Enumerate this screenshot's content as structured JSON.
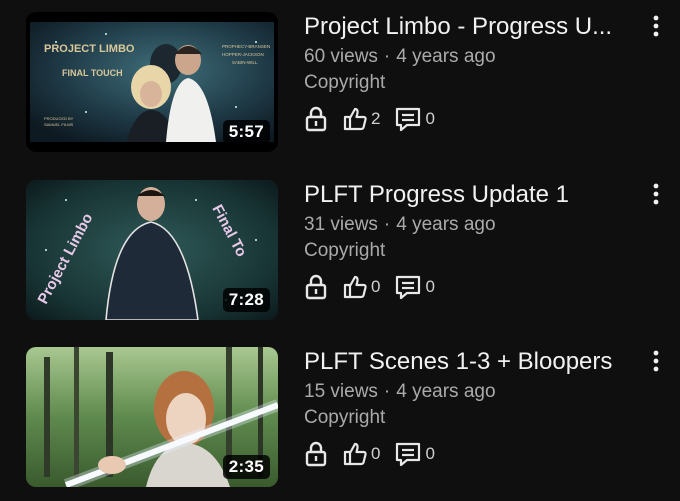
{
  "videos": [
    {
      "title": "Project Limbo - Progress U...",
      "views": "60 views",
      "age": "4 years ago",
      "visibility": "Copyright",
      "likes": "2",
      "comments": "0",
      "duration": "5:57",
      "thumb_text": {
        "title": "PROJECT LIMBO",
        "subtitle": "FINAL TOUCH",
        "credits": [
          "PROPHECY-BRANSEN",
          "HOPPER-JACKSON",
          "SABIN-WILL"
        ],
        "producer": [
          "PRODUCED BY",
          "SAMUEL FILMS"
        ]
      }
    },
    {
      "title": "PLFT Progress Update 1",
      "views": "31 views",
      "age": "4 years ago",
      "visibility": "Copyright",
      "likes": "0",
      "comments": "0",
      "duration": "7:28",
      "thumb_text": {
        "left": "Project Limbo",
        "right": "Final To"
      }
    },
    {
      "title": "PLFT Scenes 1-3 + Bloopers",
      "views": "15 views",
      "age": "4 years ago",
      "visibility": "Copyright",
      "likes": "0",
      "comments": "0",
      "duration": "2:35"
    }
  ],
  "separator": "·",
  "icons": {
    "lock": "lock-icon",
    "like": "thumbs-up-icon",
    "comment": "comment-icon",
    "more": "more-vert-icon"
  },
  "colors": {
    "background": "#0f0f0f",
    "title": "#f1f1f1",
    "secondary": "#aaaaaa"
  }
}
